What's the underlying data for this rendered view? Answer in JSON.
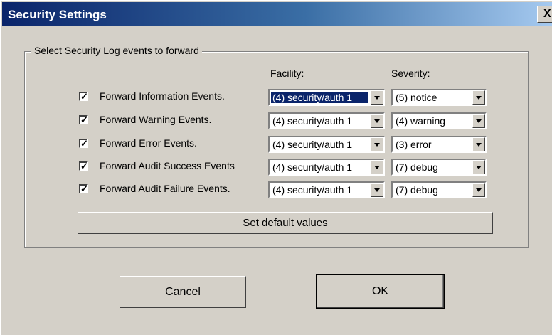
{
  "window": {
    "title": "Security Settings",
    "close_label": "X"
  },
  "group": {
    "legend": "Select Security Log events to forward"
  },
  "headers": {
    "facility": "Facility:",
    "severity": "Severity:"
  },
  "rows": [
    {
      "label": "Forward Information Events.",
      "checked": true,
      "facility": "(4) security/auth 1",
      "severity": "(5) notice"
    },
    {
      "label": "Forward Warning Events.",
      "checked": true,
      "facility": "(4) security/auth 1",
      "severity": "(4) warning"
    },
    {
      "label": "Forward Error Events.",
      "checked": true,
      "facility": "(4) security/auth 1",
      "severity": "(3) error"
    },
    {
      "label": "Forward Audit Success Events",
      "checked": true,
      "facility": "(4) security/auth 1",
      "severity": "(7) debug"
    },
    {
      "label": "Forward Audit Failure Events.",
      "checked": true,
      "facility": "(4) security/auth 1",
      "severity": "(7) debug"
    }
  ],
  "buttons": {
    "set_default": "Set default values",
    "cancel": "Cancel",
    "ok": "OK"
  },
  "check_mark": "✓"
}
